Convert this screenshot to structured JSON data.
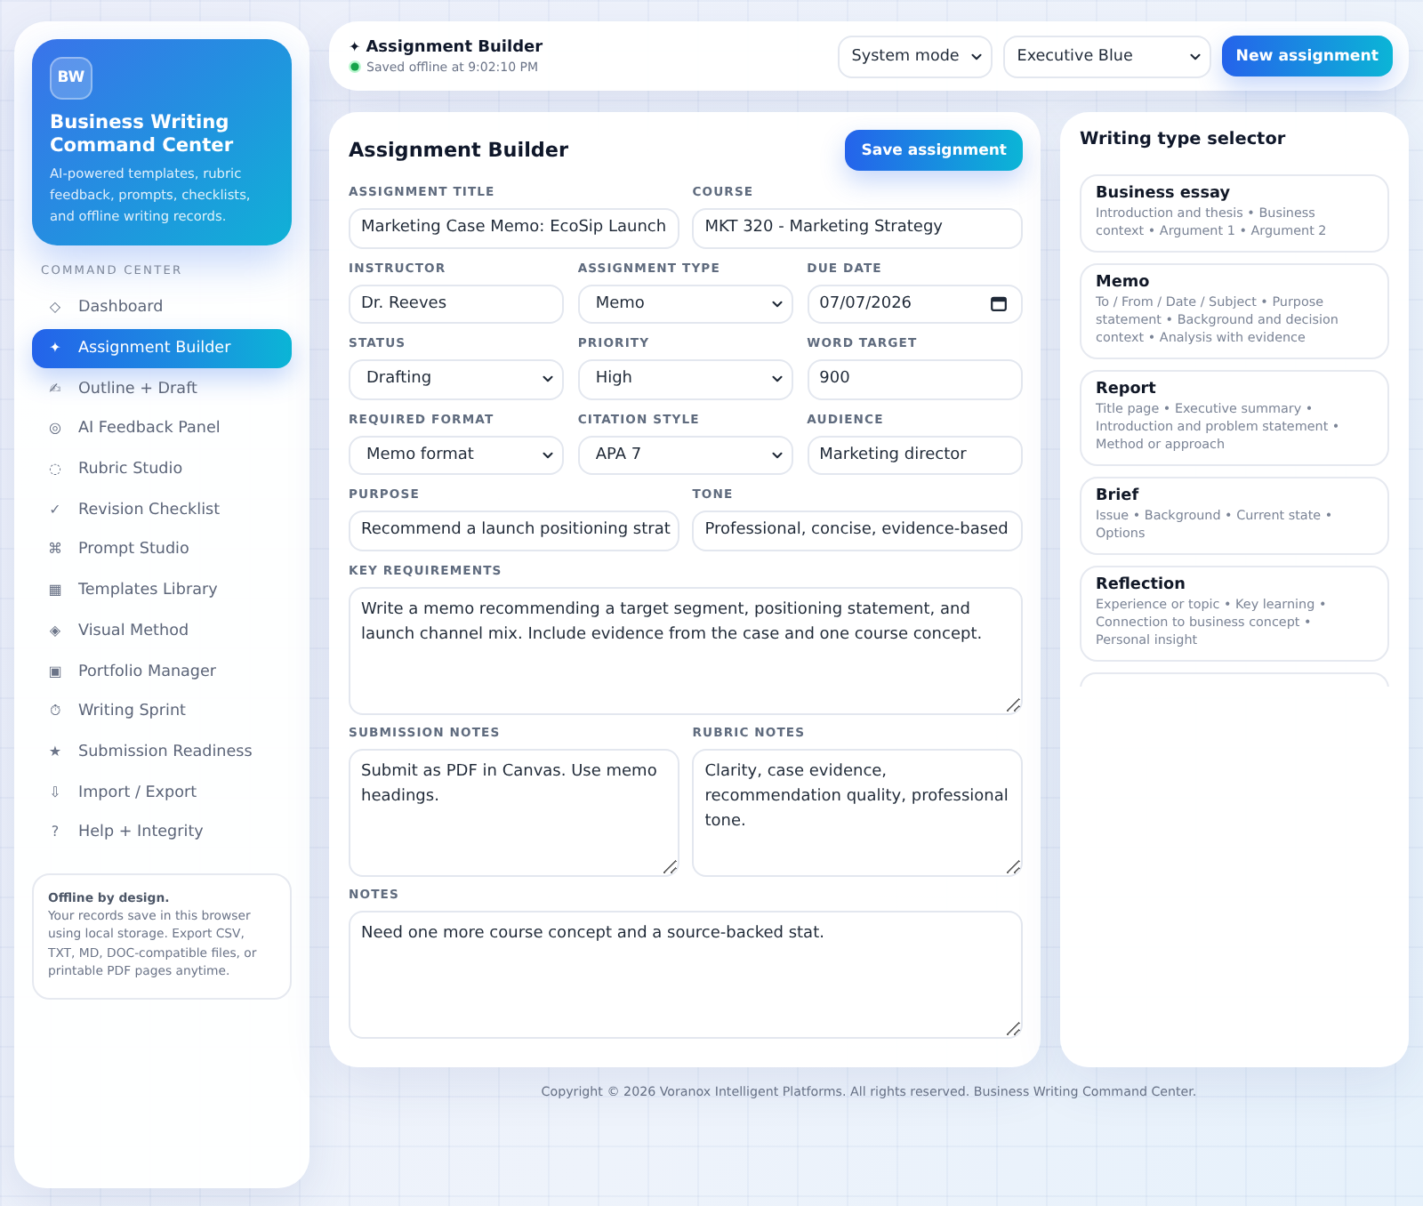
{
  "sidebar": {
    "brand": {
      "logo": "BW",
      "title": "Business Writing Command Center",
      "tagline": "AI-powered templates, rubric feedback, prompts, checklists, and offline writing records."
    },
    "section_label": "COMMAND CENTER",
    "items": [
      {
        "icon": "◇",
        "label": "Dashboard",
        "selected": false
      },
      {
        "icon": "✦",
        "label": "Assignment Builder",
        "selected": true
      },
      {
        "icon": "✍",
        "label": "Outline + Draft",
        "selected": false
      },
      {
        "icon": "◎",
        "label": "AI Feedback Panel",
        "selected": false
      },
      {
        "icon": "◌",
        "label": "Rubric Studio",
        "selected": false
      },
      {
        "icon": "✓",
        "label": "Revision Checklist",
        "selected": false
      },
      {
        "icon": "⌘",
        "label": "Prompt Studio",
        "selected": false
      },
      {
        "icon": "▦",
        "label": "Templates Library",
        "selected": false
      },
      {
        "icon": "◈",
        "label": "Visual Method",
        "selected": false
      },
      {
        "icon": "▣",
        "label": "Portfolio Manager",
        "selected": false
      },
      {
        "icon": "⏱",
        "label": "Writing Sprint",
        "selected": false
      },
      {
        "icon": "★",
        "label": "Submission Readiness",
        "selected": false
      },
      {
        "icon": "⇩",
        "label": "Import / Export",
        "selected": false
      },
      {
        "icon": "?",
        "label": "Help + Integrity",
        "selected": false
      }
    ],
    "note": {
      "title": "Offline by design.",
      "text": "Your records save in this browser using local storage. Export CSV, TXT, MD, DOC-compatible files, or printable PDF pages anytime."
    }
  },
  "top_bar": {
    "icon": "✦",
    "title": "Assignment Builder",
    "status": "Saved offline at 9:02:10 PM",
    "mode_select": "System mode",
    "theme_select": "Executive Blue",
    "primary_button": "New assignment"
  },
  "builder": {
    "title": "Assignment Builder",
    "save_button": "Save assignment",
    "rows": [
      [
        {
          "label": "ASSIGNMENT TITLE",
          "kind": "text",
          "value": "Marketing Case Memo: EcoSip Launch"
        },
        {
          "label": "COURSE",
          "kind": "text",
          "value": "MKT 320 - Marketing Strategy"
        }
      ],
      [
        {
          "label": "INSTRUCTOR",
          "kind": "text",
          "value": "Dr. Reeves"
        },
        {
          "label": "ASSIGNMENT TYPE",
          "kind": "select",
          "value": "Memo"
        },
        {
          "label": "DUE DATE",
          "kind": "date",
          "value": "07/07/2026"
        }
      ],
      [
        {
          "label": "STATUS",
          "kind": "select",
          "value": "Drafting"
        },
        {
          "label": "PRIORITY",
          "kind": "select",
          "value": "High"
        },
        {
          "label": "WORD TARGET",
          "kind": "text",
          "value": "900"
        }
      ],
      [
        {
          "label": "REQUIRED FORMAT",
          "kind": "select",
          "value": "Memo format"
        },
        {
          "label": "CITATION STYLE",
          "kind": "select",
          "value": "APA 7"
        },
        {
          "label": "AUDIENCE",
          "kind": "text",
          "value": "Marketing director"
        }
      ],
      [
        {
          "label": "PURPOSE",
          "kind": "text",
          "value": "Recommend a launch positioning strat"
        },
        {
          "label": "TONE",
          "kind": "text",
          "value": "Professional, concise, evidence-based"
        }
      ],
      [
        {
          "label": "KEY REQUIREMENTS",
          "kind": "textarea",
          "value": "Write a memo recommending a target segment, positioning statement, and launch channel mix. Include evidence from the case and one course concept."
        }
      ],
      [
        {
          "label": "SUBMISSION NOTES",
          "kind": "textarea",
          "value": "Submit as PDF in Canvas. Use memo headings."
        },
        {
          "label": "RUBRIC NOTES",
          "kind": "textarea",
          "value": "Clarity, case evidence, recommendation quality, professional tone."
        }
      ],
      [
        {
          "label": "NOTES",
          "kind": "textarea",
          "value": "Need one more course concept and a source-backed stat."
        }
      ]
    ]
  },
  "writing_types": {
    "title": "Writing type selector",
    "items": [
      {
        "name": "Business essay",
        "outline": "Introduction and thesis • Business context • Argument 1 • Argument 2"
      },
      {
        "name": "Memo",
        "outline": "To / From / Date / Subject • Purpose statement • Background and decision context • Analysis with evidence"
      },
      {
        "name": "Report",
        "outline": "Title page • Executive summary • Introduction and problem statement • Method or approach"
      },
      {
        "name": "Brief",
        "outline": "Issue • Background • Current state • Options"
      },
      {
        "name": "Reflection",
        "outline": "Experience or topic • Key learning • Connection to business concept • Personal insight"
      }
    ]
  },
  "footer": "Copyright © 2026 Voranox Intelligent Platforms. All rights reserved. Business Writing Command Center."
}
